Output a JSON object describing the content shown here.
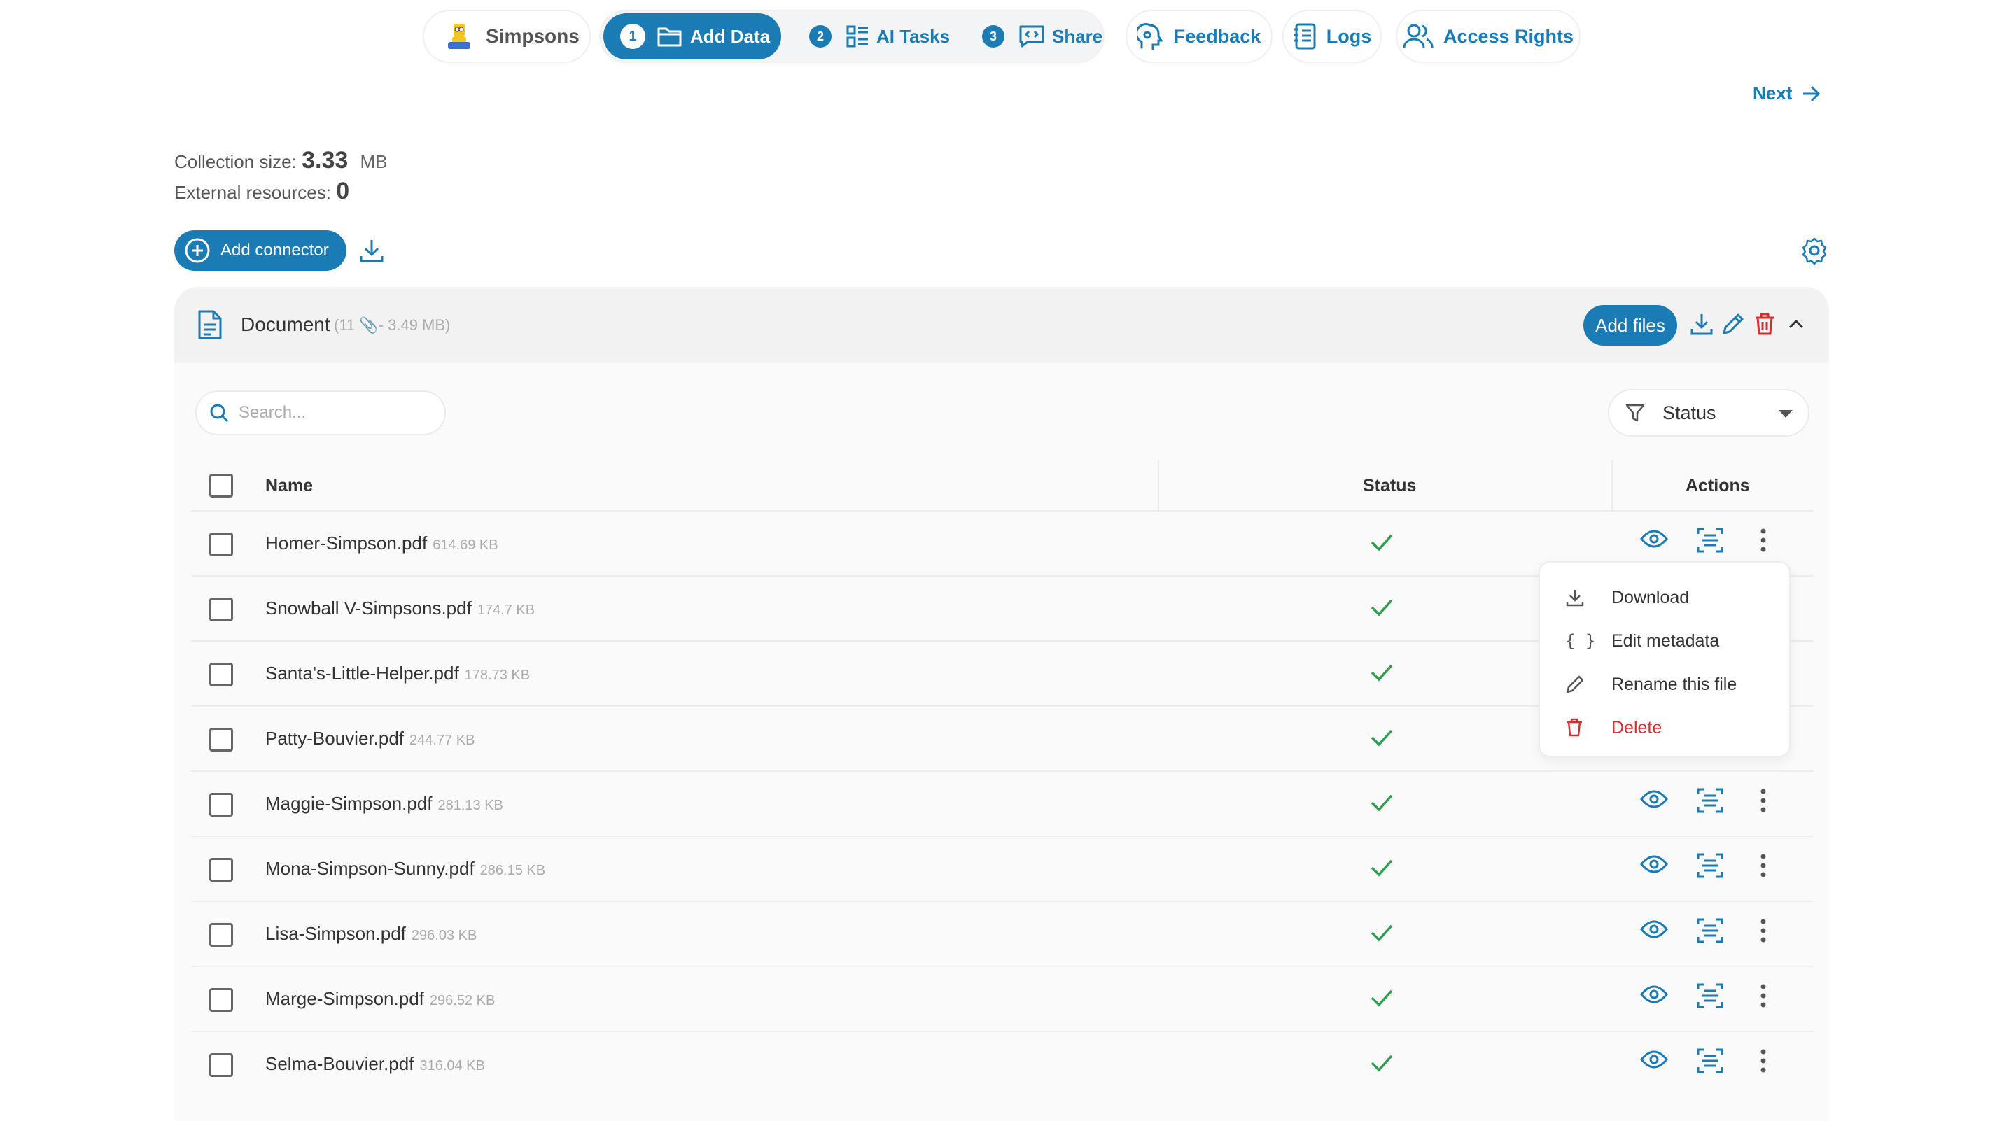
{
  "nav": {
    "project": "Simpsons",
    "steps": [
      {
        "num": "1",
        "label": "Add Data"
      },
      {
        "num": "2",
        "label": "AI Tasks"
      },
      {
        "num": "3",
        "label": "Share"
      }
    ],
    "links": {
      "feedback": "Feedback",
      "logs": "Logs",
      "access": "Access Rights"
    },
    "next": "Next"
  },
  "collection": {
    "size_label": "Collection size:",
    "size_value": "3.33",
    "size_unit": "MB",
    "external_label": "External resources:",
    "external_value": "0"
  },
  "toolbar": {
    "add_connector": "Add connector"
  },
  "document": {
    "title": "Document",
    "meta": "(11 📎- 3.49 MB)",
    "add_files": "Add files"
  },
  "table": {
    "search_placeholder": "Search...",
    "status_filter": "Status",
    "columns": {
      "name": "Name",
      "status": "Status",
      "actions": "Actions"
    },
    "rows": [
      {
        "name": "Homer-Simpson.pdf",
        "size": "614.69 KB"
      },
      {
        "name": "Snowball V-Simpsons.pdf",
        "size": "174.7 KB"
      },
      {
        "name": "Santa's-Little-Helper.pdf",
        "size": "178.73 KB"
      },
      {
        "name": "Patty-Bouvier.pdf",
        "size": "244.77 KB"
      },
      {
        "name": "Maggie-Simpson.pdf",
        "size": "281.13 KB"
      },
      {
        "name": "Mona-Simpson-Sunny.pdf",
        "size": "286.15 KB"
      },
      {
        "name": "Lisa-Simpson.pdf",
        "size": "296.03 KB"
      },
      {
        "name": "Marge-Simpson.pdf",
        "size": "296.52 KB"
      },
      {
        "name": "Selma-Bouvier.pdf",
        "size": "316.04 KB"
      }
    ]
  },
  "menu": {
    "items": [
      {
        "label": "Download",
        "icon": "download-icon"
      },
      {
        "label": "Edit metadata",
        "icon": "braces-icon"
      },
      {
        "label": "Rename this file",
        "icon": "pencil-icon"
      },
      {
        "label": "Delete",
        "icon": "trash-icon"
      }
    ]
  },
  "colors": {
    "accent": "#1a7bb5",
    "success": "#2e9d4e",
    "danger": "#d32f2f"
  }
}
